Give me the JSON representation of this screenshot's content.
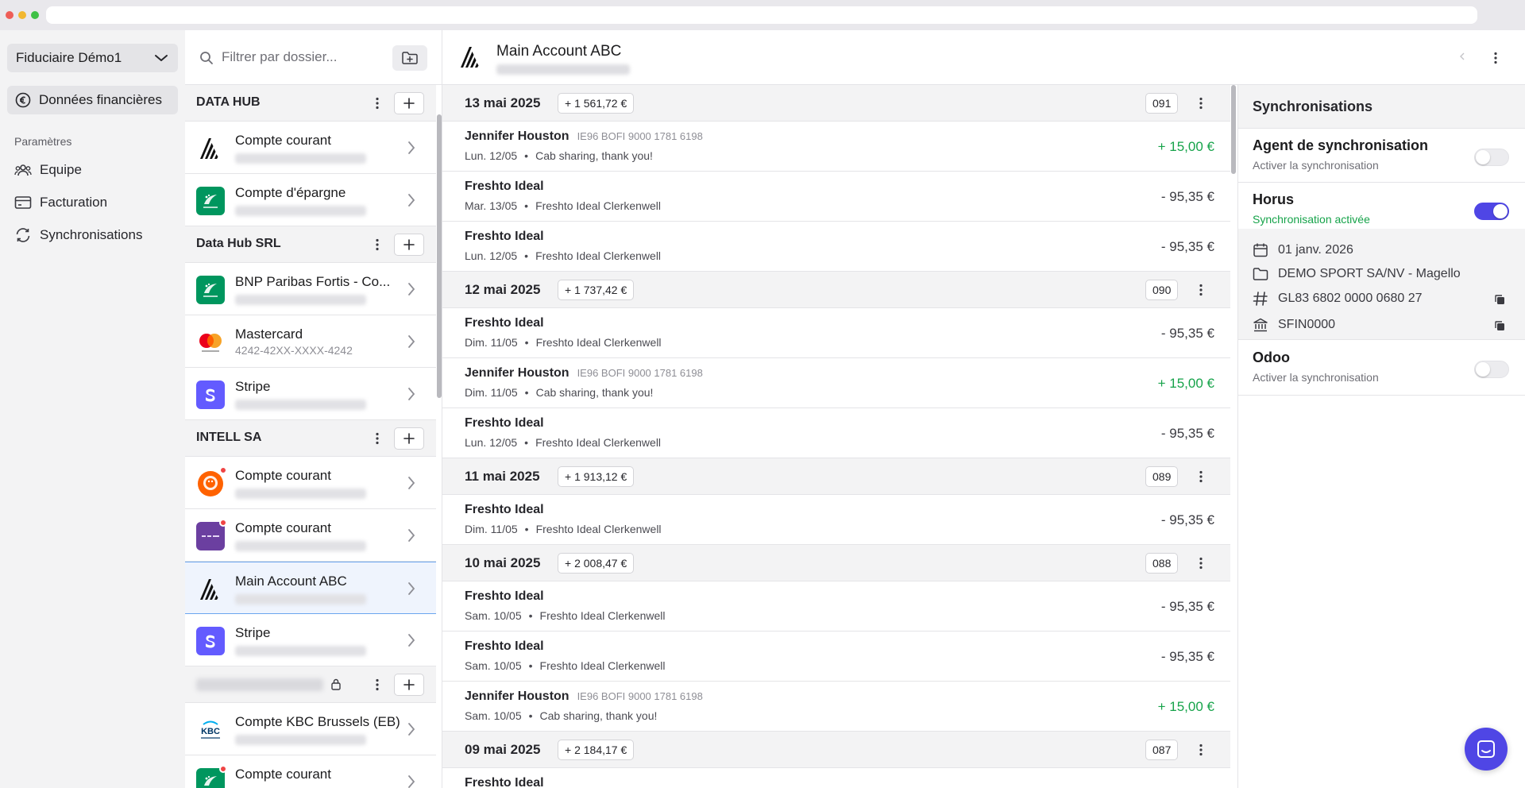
{
  "sidebar": {
    "org_name": "Fiduciaire Démo1",
    "active_nav": "Données financières",
    "section_label": "Paramètres",
    "items": [
      {
        "label": "Equipe"
      },
      {
        "label": "Facturation"
      },
      {
        "label": "Synchronisations"
      }
    ]
  },
  "accounts": {
    "search_placeholder": "Filtrer par dossier...",
    "groups": [
      {
        "name": "DATA HUB",
        "accounts": [
          {
            "name": "Compte courant",
            "logo": "triangle-logo"
          },
          {
            "name": "Compte d'épargne",
            "logo": "bnp-logo"
          }
        ]
      },
      {
        "name": "Data Hub SRL",
        "accounts": [
          {
            "name": "BNP Paribas Fortis - Co...",
            "logo": "bnp-logo"
          },
          {
            "name": "Mastercard",
            "sub": "4242-42XX-XXXX-4242",
            "logo": "mastercard-logo"
          },
          {
            "name": "Stripe",
            "logo": "stripe-logo"
          }
        ]
      },
      {
        "name": "INTELL SA",
        "accounts": [
          {
            "name": "Compte courant",
            "logo": "ing-logo",
            "alert": true
          },
          {
            "name": "Compte courant",
            "logo": "purple-bank-logo",
            "alert": true
          },
          {
            "name": "Main Account ABC",
            "logo": "triangle-logo",
            "selected": true
          },
          {
            "name": "Stripe",
            "logo": "stripe-logo"
          }
        ]
      },
      {
        "name": "",
        "locked": true,
        "accounts": [
          {
            "name": "Compte KBC Brussels (EB)",
            "logo": "kbc-logo"
          },
          {
            "name": "Compte courant",
            "logo": "bnp-logo",
            "alert": true
          }
        ]
      }
    ]
  },
  "main": {
    "title": "Main Account ABC",
    "days": [
      {
        "date": "13 mai 2025",
        "sum": "+ 1 561,72 €",
        "num": "091",
        "tx": [
          {
            "name": "Jennifer Houston",
            "iban": "IE96 BOFI 9000 1781 6198",
            "date": "Lun. 12/05",
            "desc": "Cab sharing, thank you!",
            "amount": "+ 15,00 €",
            "positive": true
          },
          {
            "name": "Freshto Ideal",
            "iban": "",
            "date": "Mar. 13/05",
            "desc": "Freshto Ideal Clerkenwell",
            "amount": "- 95,35 €",
            "positive": false
          },
          {
            "name": "Freshto Ideal",
            "iban": "",
            "date": "Lun. 12/05",
            "desc": "Freshto Ideal Clerkenwell",
            "amount": "- 95,35 €",
            "positive": false
          }
        ]
      },
      {
        "date": "12 mai 2025",
        "sum": "+ 1 737,42 €",
        "num": "090",
        "tx": [
          {
            "name": "Freshto Ideal",
            "iban": "",
            "date": "Dim. 11/05",
            "desc": "Freshto Ideal Clerkenwell",
            "amount": "- 95,35 €",
            "positive": false
          },
          {
            "name": "Jennifer Houston",
            "iban": "IE96 BOFI 9000 1781 6198",
            "date": "Dim. 11/05",
            "desc": "Cab sharing, thank you!",
            "amount": "+ 15,00 €",
            "positive": true
          },
          {
            "name": "Freshto Ideal",
            "iban": "",
            "date": "Lun. 12/05",
            "desc": "Freshto Ideal Clerkenwell",
            "amount": "- 95,35 €",
            "positive": false
          }
        ]
      },
      {
        "date": "11 mai 2025",
        "sum": "+ 1 913,12 €",
        "num": "089",
        "tx": [
          {
            "name": "Freshto Ideal",
            "iban": "",
            "date": "Dim. 11/05",
            "desc": "Freshto Ideal Clerkenwell",
            "amount": "- 95,35 €",
            "positive": false
          }
        ]
      },
      {
        "date": "10 mai 2025",
        "sum": "+ 2 008,47 €",
        "num": "088",
        "tx": [
          {
            "name": "Freshto Ideal",
            "iban": "",
            "date": "Sam. 10/05",
            "desc": "Freshto Ideal Clerkenwell",
            "amount": "- 95,35 €",
            "positive": false
          },
          {
            "name": "Freshto Ideal",
            "iban": "",
            "date": "Sam. 10/05",
            "desc": "Freshto Ideal Clerkenwell",
            "amount": "- 95,35 €",
            "positive": false
          },
          {
            "name": "Jennifer Houston",
            "iban": "IE96 BOFI 9000 1781 6198",
            "date": "Sam. 10/05",
            "desc": "Cab sharing, thank you!",
            "amount": "+ 15,00 €",
            "positive": true
          }
        ]
      },
      {
        "date": "09 mai 2025",
        "sum": "+ 2 184,17 €",
        "num": "087",
        "tx": [
          {
            "name": "Freshto Ideal",
            "iban": "",
            "date": "",
            "desc": "",
            "amount": "",
            "positive": false
          }
        ]
      }
    ]
  },
  "sync": {
    "title": "Synchronisations",
    "agent": {
      "name": "Agent de synchronisation",
      "status": "Activer la synchronisation",
      "enabled": false
    },
    "horus": {
      "name": "Horus",
      "status": "Synchronisation activée",
      "enabled": true
    },
    "details": {
      "date": "01 janv. 2026",
      "folder": "DEMO SPORT SA/NV - Magello",
      "iban": "GL83 6802 0000 0680 27",
      "bic": "SFIN0000"
    },
    "odoo": {
      "name": "Odoo",
      "status": "Activer la synchronisation",
      "enabled": false
    }
  },
  "colors": {
    "accent": "#4f46e5",
    "positive": "#16a34a",
    "selected_border": "#6aa5ee",
    "alert": "#ef4444"
  }
}
